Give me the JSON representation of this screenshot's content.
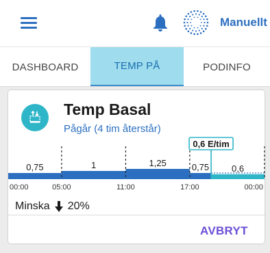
{
  "header": {
    "menu_icon": "menu-icon",
    "bell_icon": "bell-icon",
    "pod_icon": "pod-status-icon",
    "mode_label": "Manuellt"
  },
  "tabs": [
    {
      "label": "DASHBOARD",
      "active": false
    },
    {
      "label": "TEMP PÅ",
      "active": true
    },
    {
      "label": "PODINFO",
      "active": false
    }
  ],
  "card": {
    "icon": "temp-basal-icon",
    "title": "Temp Basal",
    "subtitle": "Pågår (4 tim återstår)",
    "current_rate_label": "0,6 E/tim",
    "adjust_label": "Minska",
    "adjust_value": "20%",
    "cancel_label": "AVBRYT"
  },
  "chart_data": {
    "type": "step",
    "segments": [
      {
        "label": "0,75",
        "start": "00:00",
        "end": "05:00",
        "value": 0.75
      },
      {
        "label": "1",
        "start": "05:00",
        "end": "11:00",
        "value": 1.0
      },
      {
        "label": "1,25",
        "start": "11:00",
        "end": "17:00",
        "value": 1.25
      },
      {
        "label": "0,75",
        "start": "17:00",
        "end": "19:00",
        "value": 0.75
      },
      {
        "label": "0,6",
        "start": "19:00",
        "end": "24:00",
        "value": 0.6
      }
    ],
    "x_ticks": [
      "00:00",
      "05:00",
      "11:00",
      "17:00",
      "00:00"
    ],
    "colors": {
      "basal": "#2c6fc0",
      "temp": "#2eb6c8"
    }
  }
}
